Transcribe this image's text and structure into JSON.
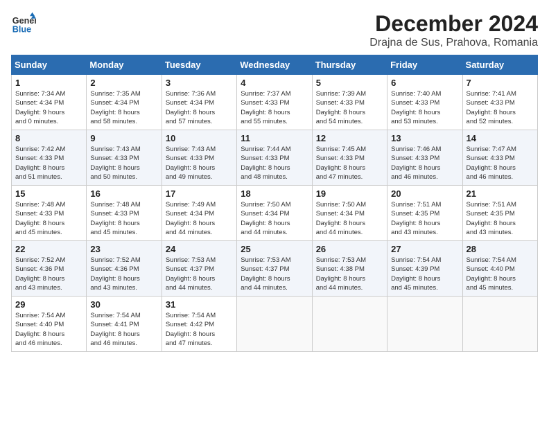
{
  "header": {
    "logo_line1": "General",
    "logo_line2": "Blue",
    "title": "December 2024",
    "subtitle": "Drajna de Sus, Prahova, Romania"
  },
  "weekdays": [
    "Sunday",
    "Monday",
    "Tuesday",
    "Wednesday",
    "Thursday",
    "Friday",
    "Saturday"
  ],
  "weeks": [
    [
      {
        "day": "1",
        "info": "Sunrise: 7:34 AM\nSunset: 4:34 PM\nDaylight: 9 hours\nand 0 minutes."
      },
      {
        "day": "2",
        "info": "Sunrise: 7:35 AM\nSunset: 4:34 PM\nDaylight: 8 hours\nand 58 minutes."
      },
      {
        "day": "3",
        "info": "Sunrise: 7:36 AM\nSunset: 4:34 PM\nDaylight: 8 hours\nand 57 minutes."
      },
      {
        "day": "4",
        "info": "Sunrise: 7:37 AM\nSunset: 4:33 PM\nDaylight: 8 hours\nand 55 minutes."
      },
      {
        "day": "5",
        "info": "Sunrise: 7:39 AM\nSunset: 4:33 PM\nDaylight: 8 hours\nand 54 minutes."
      },
      {
        "day": "6",
        "info": "Sunrise: 7:40 AM\nSunset: 4:33 PM\nDaylight: 8 hours\nand 53 minutes."
      },
      {
        "day": "7",
        "info": "Sunrise: 7:41 AM\nSunset: 4:33 PM\nDaylight: 8 hours\nand 52 minutes."
      }
    ],
    [
      {
        "day": "8",
        "info": "Sunrise: 7:42 AM\nSunset: 4:33 PM\nDaylight: 8 hours\nand 51 minutes."
      },
      {
        "day": "9",
        "info": "Sunrise: 7:43 AM\nSunset: 4:33 PM\nDaylight: 8 hours\nand 50 minutes."
      },
      {
        "day": "10",
        "info": "Sunrise: 7:43 AM\nSunset: 4:33 PM\nDaylight: 8 hours\nand 49 minutes."
      },
      {
        "day": "11",
        "info": "Sunrise: 7:44 AM\nSunset: 4:33 PM\nDaylight: 8 hours\nand 48 minutes."
      },
      {
        "day": "12",
        "info": "Sunrise: 7:45 AM\nSunset: 4:33 PM\nDaylight: 8 hours\nand 47 minutes."
      },
      {
        "day": "13",
        "info": "Sunrise: 7:46 AM\nSunset: 4:33 PM\nDaylight: 8 hours\nand 46 minutes."
      },
      {
        "day": "14",
        "info": "Sunrise: 7:47 AM\nSunset: 4:33 PM\nDaylight: 8 hours\nand 46 minutes."
      }
    ],
    [
      {
        "day": "15",
        "info": "Sunrise: 7:48 AM\nSunset: 4:33 PM\nDaylight: 8 hours\nand 45 minutes."
      },
      {
        "day": "16",
        "info": "Sunrise: 7:48 AM\nSunset: 4:33 PM\nDaylight: 8 hours\nand 45 minutes."
      },
      {
        "day": "17",
        "info": "Sunrise: 7:49 AM\nSunset: 4:34 PM\nDaylight: 8 hours\nand 44 minutes."
      },
      {
        "day": "18",
        "info": "Sunrise: 7:50 AM\nSunset: 4:34 PM\nDaylight: 8 hours\nand 44 minutes."
      },
      {
        "day": "19",
        "info": "Sunrise: 7:50 AM\nSunset: 4:34 PM\nDaylight: 8 hours\nand 44 minutes."
      },
      {
        "day": "20",
        "info": "Sunrise: 7:51 AM\nSunset: 4:35 PM\nDaylight: 8 hours\nand 43 minutes."
      },
      {
        "day": "21",
        "info": "Sunrise: 7:51 AM\nSunset: 4:35 PM\nDaylight: 8 hours\nand 43 minutes."
      }
    ],
    [
      {
        "day": "22",
        "info": "Sunrise: 7:52 AM\nSunset: 4:36 PM\nDaylight: 8 hours\nand 43 minutes."
      },
      {
        "day": "23",
        "info": "Sunrise: 7:52 AM\nSunset: 4:36 PM\nDaylight: 8 hours\nand 43 minutes."
      },
      {
        "day": "24",
        "info": "Sunrise: 7:53 AM\nSunset: 4:37 PM\nDaylight: 8 hours\nand 44 minutes."
      },
      {
        "day": "25",
        "info": "Sunrise: 7:53 AM\nSunset: 4:37 PM\nDaylight: 8 hours\nand 44 minutes."
      },
      {
        "day": "26",
        "info": "Sunrise: 7:53 AM\nSunset: 4:38 PM\nDaylight: 8 hours\nand 44 minutes."
      },
      {
        "day": "27",
        "info": "Sunrise: 7:54 AM\nSunset: 4:39 PM\nDaylight: 8 hours\nand 45 minutes."
      },
      {
        "day": "28",
        "info": "Sunrise: 7:54 AM\nSunset: 4:40 PM\nDaylight: 8 hours\nand 45 minutes."
      }
    ],
    [
      {
        "day": "29",
        "info": "Sunrise: 7:54 AM\nSunset: 4:40 PM\nDaylight: 8 hours\nand 46 minutes."
      },
      {
        "day": "30",
        "info": "Sunrise: 7:54 AM\nSunset: 4:41 PM\nDaylight: 8 hours\nand 46 minutes."
      },
      {
        "day": "31",
        "info": "Sunrise: 7:54 AM\nSunset: 4:42 PM\nDaylight: 8 hours\nand 47 minutes."
      },
      null,
      null,
      null,
      null
    ]
  ]
}
